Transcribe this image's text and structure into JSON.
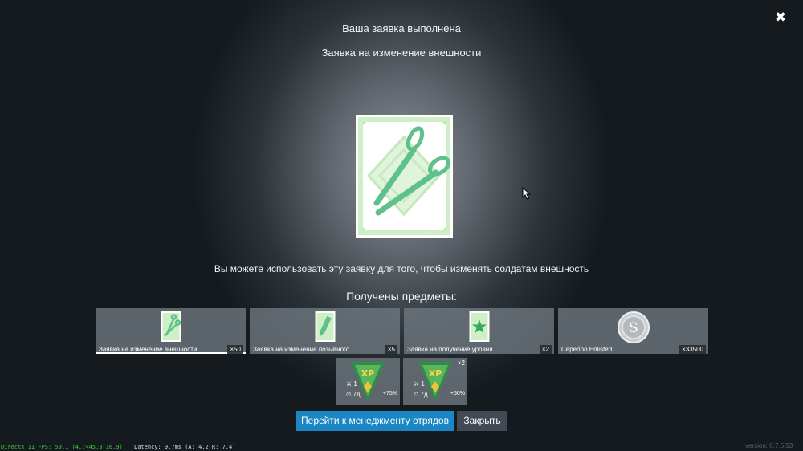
{
  "header": {
    "close_icon": "close-icon",
    "title": "Ваша заявка выполнена"
  },
  "reward": {
    "name": "Заявка на изменение внешности",
    "icon": "scissors-icon",
    "description": "Вы можете использовать эту заявку для того, чтобы изменять солдатам внешность"
  },
  "received": {
    "heading": "Получены предметы:",
    "items": [
      {
        "label": "Заявка на изменение внешности",
        "qty": "×50",
        "icon": "scissors-icon"
      },
      {
        "label": "Заявка на изменение позывного",
        "qty": "×5",
        "icon": "pencil-icon"
      },
      {
        "label": "Заявка на получение уровня",
        "qty": "×2",
        "icon": "star-icon"
      },
      {
        "label": "Серебро Enlisted",
        "qty": "×33500",
        "icon": "silver-coin-icon"
      }
    ],
    "boosters": [
      {
        "badge": "XP",
        "count": "1",
        "duration": "7д.",
        "bonus": "+75%",
        "multiplier": ""
      },
      {
        "badge": "XP",
        "count": "1",
        "duration": "7д.",
        "bonus": "+50%",
        "multiplier": "×2"
      }
    ]
  },
  "actions": {
    "primary": "Перейти к менеджменту отрядов",
    "close": "Закрыть"
  },
  "debug": {
    "fps": "DirectX 11 FPS: 59.1 (4.7<45.3 16.9)",
    "latency": "Latency: 9.7ms (A: 4.2 R: 7.4)",
    "version": "version: 0.7.6.53"
  },
  "colors": {
    "accent": "#1a86c4",
    "card_green": "#5ec08a",
    "card_bg_green": "#cfefc6",
    "debug_green": "#35d13a"
  }
}
